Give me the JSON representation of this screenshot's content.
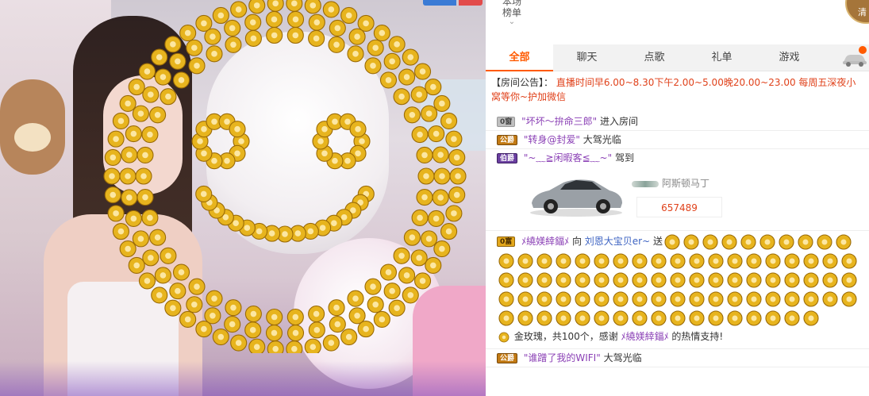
{
  "colors": {
    "accent": "#ff5a00",
    "notice": "#e0421b",
    "username_purple": "#8a3fb5",
    "username_blue": "#3d63c2",
    "rose_gold": "#e7b41e"
  },
  "header": {
    "rank_toggle": {
      "line1": "本场",
      "line2": "榜单",
      "icon": "chevron-down-icon"
    },
    "corner_avatar_text": "清"
  },
  "tabs": [
    {
      "label": "全部",
      "active": true
    },
    {
      "label": "聊天",
      "active": false
    },
    {
      "label": "点歌",
      "active": false
    },
    {
      "label": "礼单",
      "active": false
    },
    {
      "label": "游戏",
      "active": false
    }
  ],
  "notice": {
    "prefix": "【房间公告】：",
    "text": "直播时间早6.00~8.30下午2.00~5.00晚20.00~23.00 每周五深夜小窝等你~护加微信"
  },
  "chat": {
    "messages": [
      {
        "badge": "0窗",
        "user": "\"坏坏～拚命三郎\"",
        "action": "进入房间"
      },
      {
        "badge": "公爵",
        "user": "\"转身@封爱\"",
        "action": "大驾光临"
      },
      {
        "badge": "伯爵",
        "user": "\"~﹏≧闲暇客≦﹏~\"",
        "action": "驾到"
      }
    ],
    "car": {
      "brand": "阿斯顿马丁",
      "price": "657489",
      "icon": "aston-martin-car"
    },
    "gift": {
      "badge": "0富",
      "sender": "ﾒ繞媄緈鍢ﾒ",
      "to": "向",
      "recipient": "刘恩大宝贝er~",
      "verb": "送",
      "summary_prefix": "金玫瑰，共100个，感谢",
      "thanks_user": "ﾒ繞媄緈鍢ﾒ",
      "summary_suffix": "的热情支持!",
      "count": 100,
      "icon": "gold-rose-icon"
    },
    "last": {
      "badge": "公爵",
      "user": "\"谁蹭了我的WIFI\"",
      "action": "大驾光临"
    }
  }
}
